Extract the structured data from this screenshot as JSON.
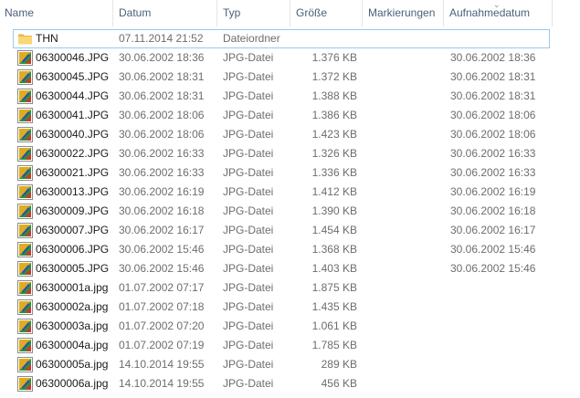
{
  "columns": {
    "name": "Name",
    "date": "Datum",
    "type": "Typ",
    "size": "Größe",
    "tags": "Markierungen",
    "taken": "Aufnahmedatum"
  },
  "sort_indicator": "⌄",
  "files": [
    {
      "icon": "folder-icon",
      "name": "THN",
      "date": "07.11.2014 21:52",
      "type": "Dateiordner",
      "size": "",
      "taken": "",
      "selected": true
    },
    {
      "icon": "jpg-file-icon",
      "name": "06300046.JPG",
      "date": "30.06.2002 18:36",
      "type": "JPG-Datei",
      "size": "1.376 KB",
      "taken": "30.06.2002 18:36"
    },
    {
      "icon": "jpg-file-icon",
      "name": "06300045.JPG",
      "date": "30.06.2002 18:31",
      "type": "JPG-Datei",
      "size": "1.372 KB",
      "taken": "30.06.2002 18:31"
    },
    {
      "icon": "jpg-file-icon",
      "name": "06300044.JPG",
      "date": "30.06.2002 18:31",
      "type": "JPG-Datei",
      "size": "1.388 KB",
      "taken": "30.06.2002 18:31"
    },
    {
      "icon": "jpg-file-icon",
      "name": "06300041.JPG",
      "date": "30.06.2002 18:06",
      "type": "JPG-Datei",
      "size": "1.386 KB",
      "taken": "30.06.2002 18:06"
    },
    {
      "icon": "jpg-file-icon",
      "name": "06300040.JPG",
      "date": "30.06.2002 18:06",
      "type": "JPG-Datei",
      "size": "1.423 KB",
      "taken": "30.06.2002 18:06"
    },
    {
      "icon": "jpg-file-icon",
      "name": "06300022.JPG",
      "date": "30.06.2002 16:33",
      "type": "JPG-Datei",
      "size": "1.326 KB",
      "taken": "30.06.2002 16:33"
    },
    {
      "icon": "jpg-file-icon",
      "name": "06300021.JPG",
      "date": "30.06.2002 16:33",
      "type": "JPG-Datei",
      "size": "1.336 KB",
      "taken": "30.06.2002 16:33"
    },
    {
      "icon": "jpg-file-icon",
      "name": "06300013.JPG",
      "date": "30.06.2002 16:19",
      "type": "JPG-Datei",
      "size": "1.412 KB",
      "taken": "30.06.2002 16:19"
    },
    {
      "icon": "jpg-file-icon",
      "name": "06300009.JPG",
      "date": "30.06.2002 16:18",
      "type": "JPG-Datei",
      "size": "1.390 KB",
      "taken": "30.06.2002 16:18"
    },
    {
      "icon": "jpg-file-icon",
      "name": "06300007.JPG",
      "date": "30.06.2002 16:17",
      "type": "JPG-Datei",
      "size": "1.454 KB",
      "taken": "30.06.2002 16:17"
    },
    {
      "icon": "jpg-file-icon",
      "name": "06300006.JPG",
      "date": "30.06.2002 15:46",
      "type": "JPG-Datei",
      "size": "1.368 KB",
      "taken": "30.06.2002 15:46"
    },
    {
      "icon": "jpg-file-icon",
      "name": "06300005.JPG",
      "date": "30.06.2002 15:46",
      "type": "JPG-Datei",
      "size": "1.403 KB",
      "taken": "30.06.2002 15:46"
    },
    {
      "icon": "jpg-file-icon",
      "name": "06300001a.jpg",
      "date": "01.07.2002 07:17",
      "type": "JPG-Datei",
      "size": "1.875 KB",
      "taken": ""
    },
    {
      "icon": "jpg-file-icon",
      "name": "06300002a.jpg",
      "date": "01.07.2002 07:18",
      "type": "JPG-Datei",
      "size": "1.435 KB",
      "taken": ""
    },
    {
      "icon": "jpg-file-icon",
      "name": "06300003a.jpg",
      "date": "01.07.2002 07:20",
      "type": "JPG-Datei",
      "size": "1.061 KB",
      "taken": ""
    },
    {
      "icon": "jpg-file-icon",
      "name": "06300004a.jpg",
      "date": "01.07.2002 07:19",
      "type": "JPG-Datei",
      "size": "1.785 KB",
      "taken": ""
    },
    {
      "icon": "jpg-file-icon",
      "name": "06300005a.jpg",
      "date": "14.10.2014 19:55",
      "type": "JPG-Datei",
      "size": "289 KB",
      "taken": ""
    },
    {
      "icon": "jpg-file-icon",
      "name": "06300006a.jpg",
      "date": "14.10.2014 19:55",
      "type": "JPG-Datei",
      "size": "456 KB",
      "taken": ""
    }
  ],
  "colors": {
    "header_text": "#4c607a",
    "secondary_text": "#6d6d6d",
    "selection_border": "#99c9ef",
    "folder": "#f8d775"
  }
}
